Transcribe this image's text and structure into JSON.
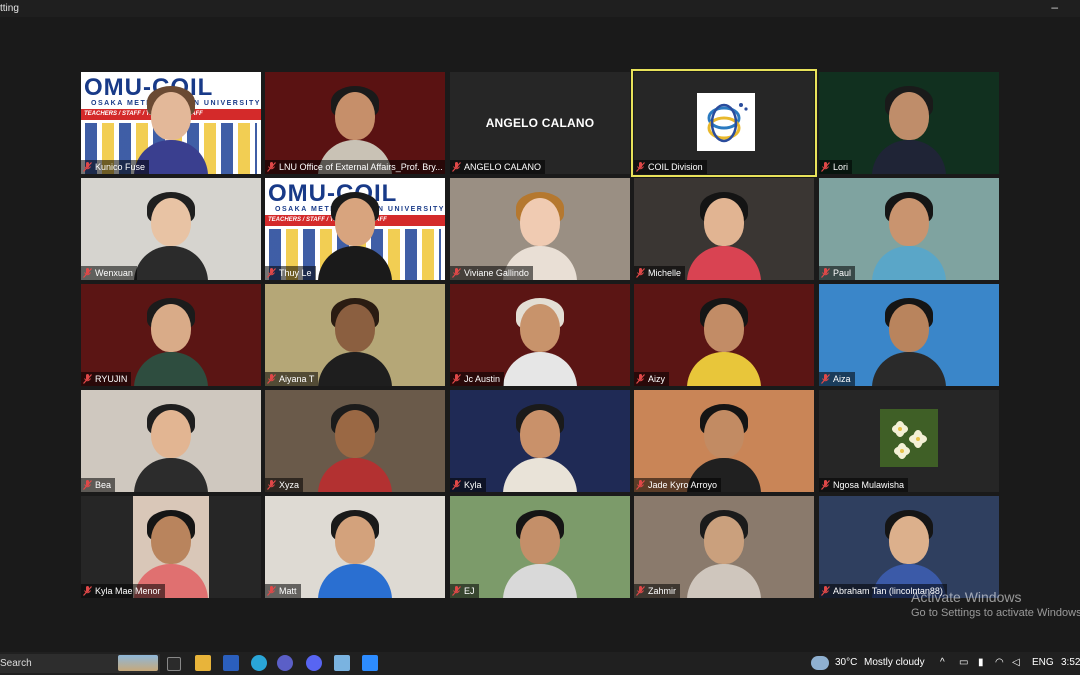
{
  "window": {
    "title": "tting",
    "minimize_glyph": "–"
  },
  "participants": [
    {
      "name": "Kunico Fuse",
      "bg": "omu",
      "skin": "#e3b899",
      "hair": "#6b4a33",
      "shirt": "#3a3f8f"
    },
    {
      "name": "LNU Office of External Affairs_Prof. Bry...",
      "bg": "#5a1212",
      "skin": "#c68f6a",
      "hair": "#1a1a1a",
      "shirt": "#c9c2b5"
    },
    {
      "name": "ANGELO CALANO",
      "bg": "#262626",
      "center_text": "ANGELO CALANO"
    },
    {
      "name": "COIL Division",
      "bg": "#262626",
      "logo": "coil",
      "active": true
    },
    {
      "name": "Lori",
      "bg": "#11301f",
      "skin": "#bf8d6a",
      "hair": "#1a1a1a",
      "shirt": "#1f2436"
    },
    {
      "name": "Wenxuan",
      "bg": "#d6d4cf",
      "skin": "#e8c3a4",
      "hair": "#1f1f1f",
      "shirt": "#2b2b2b"
    },
    {
      "name": "Thuy Le",
      "bg": "omu",
      "skin": "#d8a47e",
      "hair": "#1a1a1a",
      "shirt": "#1a1a1a"
    },
    {
      "name": "Viviane Gallindo",
      "bg": "#9a8f83",
      "skin": "#f0cbb2",
      "hair": "#b5782f",
      "shirt": "#e9dfd5"
    },
    {
      "name": "Michelle",
      "bg": "#3a3633",
      "skin": "#e1b492",
      "hair": "#141414",
      "shirt": "#d94352"
    },
    {
      "name": "Paul",
      "bg": "#7fa3a0",
      "skin": "#c9946f",
      "hair": "#151515",
      "shirt": "#5aa6c8"
    },
    {
      "name": "RYUJIN",
      "bg": "#5b1514",
      "skin": "#d9ab88",
      "hair": "#1b1b1b",
      "shirt": "#2e4d3f"
    },
    {
      "name": "Aiyana T",
      "bg": "#b5a777",
      "skin": "#8b5f40",
      "hair": "#2a1c12",
      "shirt": "#1e1e1e"
    },
    {
      "name": "Jc Austin",
      "bg": "#5b1514",
      "skin": "#c8936b",
      "hair": "#e3ded4",
      "shirt": "#e6e6e6"
    },
    {
      "name": "Aizy",
      "bg": "#5b1514",
      "skin": "#c28c66",
      "hair": "#151515",
      "shirt": "#e8c63a"
    },
    {
      "name": "Aiza",
      "bg": "#3a86c9",
      "skin": "#b9845d",
      "hair": "#151515",
      "shirt": "#2a2a2a"
    },
    {
      "name": "Bea",
      "bg": "#cfc8bf",
      "skin": "#e2b592",
      "hair": "#1e1e1e",
      "shirt": "#2c2c2c"
    },
    {
      "name": "Xyza",
      "bg": "#6a5a4a",
      "skin": "#9a6844",
      "hair": "#1b1b1b",
      "shirt": "#b33131"
    },
    {
      "name": "Kyla",
      "bg": "#1f2a55",
      "skin": "#c9916a",
      "hair": "#1a1a1a",
      "shirt": "#e9e3d8"
    },
    {
      "name": "Jade Kyro Arroyo",
      "bg": "#c98557",
      "skin": "#c28b63",
      "hair": "#141414",
      "shirt": "#202020"
    },
    {
      "name": "Ngosa Mulawisha",
      "bg": "#262626",
      "logo": "flower"
    },
    {
      "name": "Kyla Mae Menor",
      "bg": "#262626",
      "skin": "#b9845d",
      "hair": "#151515",
      "shirt": "#e07070",
      "inset": true
    },
    {
      "name": "Matt",
      "bg": "#dedad3",
      "skin": "#d3a27c",
      "hair": "#1a1a1a",
      "shirt": "#2a6fd1"
    },
    {
      "name": "EJ",
      "bg": "#7c9b6a",
      "skin": "#c48f69",
      "hair": "#151515",
      "shirt": "#d9d9d9"
    },
    {
      "name": "Zahmir",
      "bg": "#8a7a6c",
      "skin": "#caa07d",
      "hair": "#1b1b1b",
      "shirt": "#cfc6bd"
    },
    {
      "name": "Abraham Tan (lincolntan88)",
      "bg": "#2f3f5f",
      "skin": "#dcb08c",
      "hair": "#151515",
      "shirt": "#3b5aa8"
    }
  ],
  "omu_card": {
    "brand": "OMU-COIL",
    "university": "OSAKA METROPOLITAN UNIVERSITY",
    "band": "TEACHERS / STAFF / TEACHERS / STAFF"
  },
  "watermark": {
    "line1": "Activate Windows",
    "line2": "Go to Settings to activate Windows."
  },
  "taskbar": {
    "search_label": "Search",
    "weather": "30°C",
    "weather_desc": "Mostly cloudy",
    "language": "ENG",
    "time": "3:52"
  }
}
